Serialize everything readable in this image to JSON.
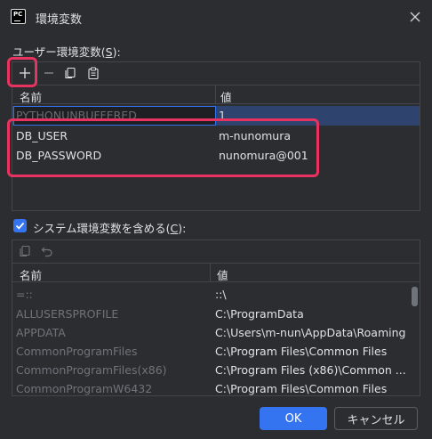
{
  "window": {
    "logo_text": "PC",
    "title": "環境変数"
  },
  "user_section": {
    "label": "ユーザー環境変数(",
    "mnemonic": "S",
    "label_end": "):",
    "columns": [
      "名前",
      "値"
    ],
    "rows": [
      {
        "name": "PYTHONUNBUFFERED",
        "value": "1"
      },
      {
        "name": "DB_USER",
        "value": "m-nunomura"
      },
      {
        "name": "DB_PASSWORD",
        "value": "nunomura@001"
      }
    ]
  },
  "system_section": {
    "checkbox_checked": true,
    "label": "システム環境変数を含める(",
    "mnemonic": "C",
    "label_end": "):",
    "columns": [
      "名前",
      "値"
    ],
    "rows": [
      {
        "name": "=::",
        "value": "::\\"
      },
      {
        "name": "ALLUSERSPROFILE",
        "value": "C:\\ProgramData"
      },
      {
        "name": "APPDATA",
        "value": "C:\\Users\\m-nun\\AppData\\Roaming"
      },
      {
        "name": "CommonProgramFiles",
        "value": "C:\\Program Files\\Common Files"
      },
      {
        "name": "CommonProgramFiles(x86)",
        "value": "C:\\Program Files (x86)\\Common ..."
      },
      {
        "name": "CommonProgramW6432",
        "value": "C:\\Program Files\\Common Files"
      }
    ]
  },
  "buttons": {
    "ok": "OK",
    "cancel": "キャンセル"
  },
  "colors": {
    "background": "#2b2d30",
    "accent": "#3574f0",
    "highlight": "#e8325f",
    "selection": "#2e436e",
    "muted_text": "#6f737a"
  }
}
